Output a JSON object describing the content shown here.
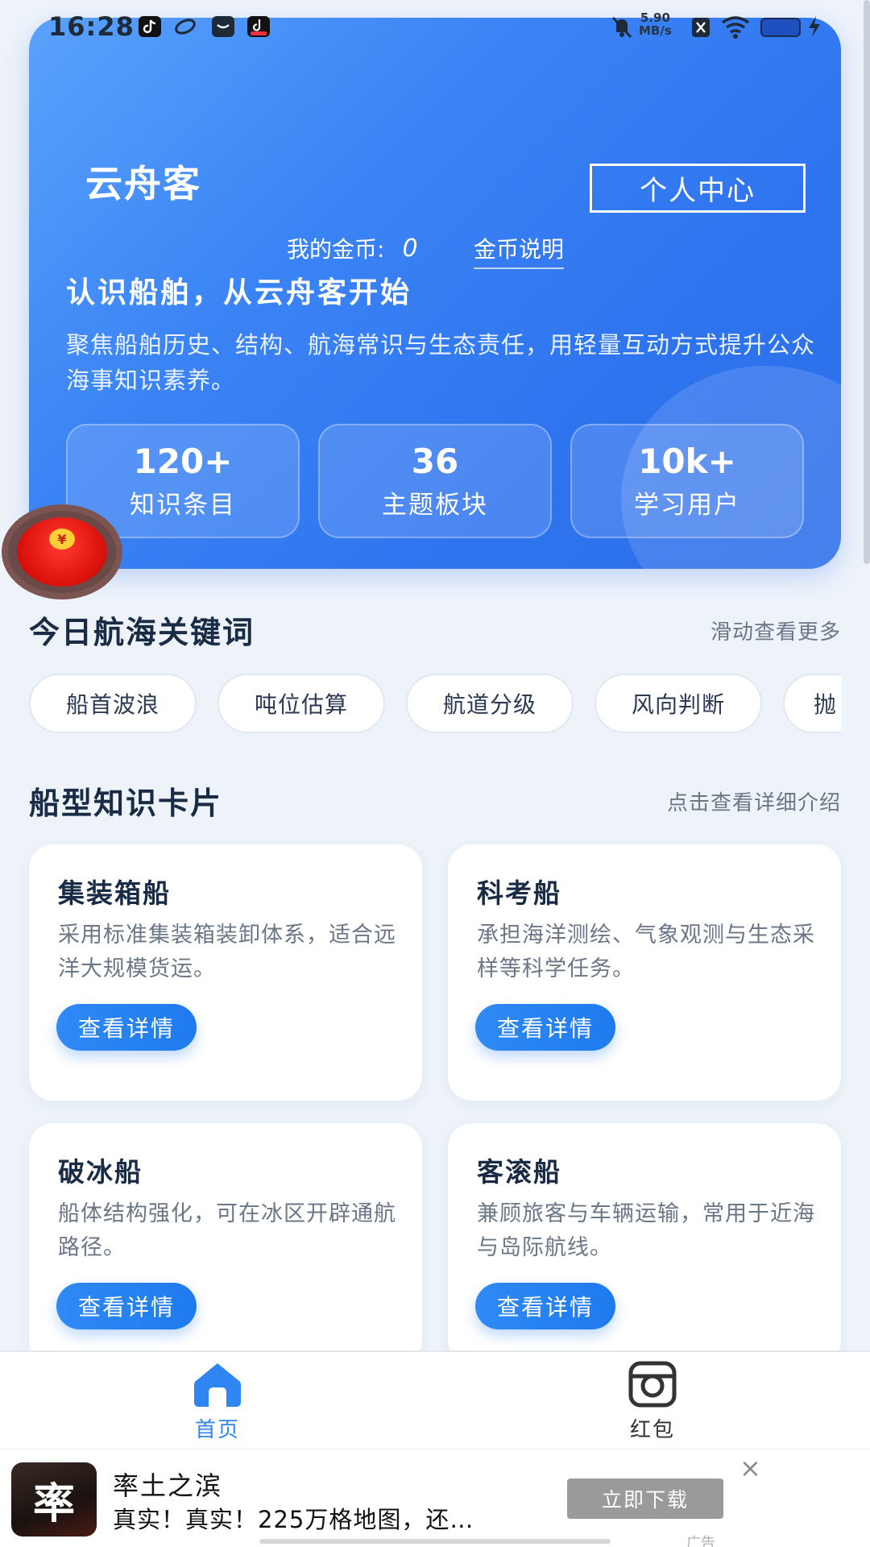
{
  "status_bar": {
    "time": "16:28",
    "net_speed_value": "5.90",
    "net_speed_unit": "MB/s"
  },
  "header": {
    "app_name": "云舟客",
    "personal_center": "个人中心",
    "coins_label": "我的金币:",
    "coins_value": "0",
    "coins_help": "金币说明"
  },
  "hero": {
    "title": "认识船舶，从云舟客开始",
    "description": "聚焦船舶历史、结构、航海常识与生态责任，用轻量互动方式提升公众海事知识素养。",
    "stats": [
      {
        "value": "120+",
        "label": "知识条目"
      },
      {
        "value": "36",
        "label": "主题板块"
      },
      {
        "value": "10k+",
        "label": "学习用户"
      }
    ]
  },
  "keywords": {
    "title": "今日航海关键词",
    "hint": "滑动查看更多",
    "chips": [
      "船首波浪",
      "吨位估算",
      "航道分级",
      "风向判断",
      "抛"
    ]
  },
  "ship_cards": {
    "title": "船型知识卡片",
    "hint": "点击查看详细介绍",
    "items": [
      {
        "title": "集装箱船",
        "desc": "采用标准集装箱装卸体系，适合远洋大规模货运。",
        "button": "查看详情"
      },
      {
        "title": "科考船",
        "desc": "承担海洋测绘、气象观测与生态采样等科学任务。",
        "button": "查看详情"
      },
      {
        "title": "破冰船",
        "desc": "船体结构强化，可在冰区开辟通航路径。",
        "button": "查看详情"
      },
      {
        "title": "客滚船",
        "desc": "兼顾旅客与车辆运输，常用于近海与岛际航线。",
        "button": "查看详情"
      }
    ]
  },
  "bottom_nav": {
    "items": [
      {
        "label": "首页",
        "icon": "home-icon",
        "active": true
      },
      {
        "label": "红包",
        "icon": "camera-icon",
        "active": false
      }
    ],
    "active_color": "#2f86f3",
    "inactive_color": "#333333"
  },
  "ad": {
    "icon_text": "率",
    "title": "率土之滨",
    "description": "真实！真实！225万格地图，还…",
    "download": "立即下载",
    "close": "×",
    "tag": "广告"
  },
  "colors": {
    "hero_blue": "#3b84f5",
    "button_blue": "#1f7aef",
    "page_bg": "#eef3fa"
  }
}
